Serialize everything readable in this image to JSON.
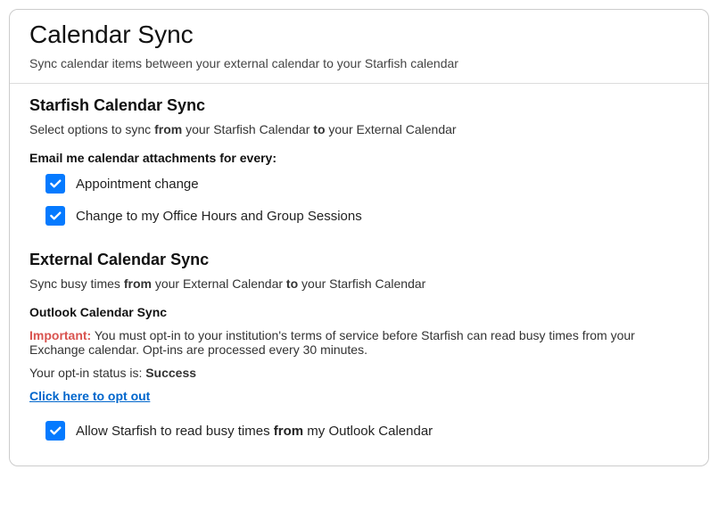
{
  "header": {
    "title": "Calendar Sync",
    "subtitle": "Sync calendar items between your external calendar to your Starfish calendar"
  },
  "starfish_sync": {
    "title": "Starfish Calendar Sync",
    "desc_prefix": "Select options to sync ",
    "desc_from": "from",
    "desc_mid": " your Starfish Calendar ",
    "desc_to": "to",
    "desc_suffix": " your External Calendar",
    "email_heading": "Email me calendar attachments for every:",
    "opt1": "Appointment change",
    "opt2": "Change to my Office Hours and Group Sessions"
  },
  "external_sync": {
    "title": "External Calendar Sync",
    "desc_prefix": "Sync busy times ",
    "desc_from": "from",
    "desc_mid": " your External Calendar ",
    "desc_to": "to",
    "desc_suffix": " your Starfish Calendar",
    "outlook_title": "Outlook Calendar Sync",
    "important_label": "Important:",
    "important_text": " You must opt-in to your institution's terms of service before Starfish can read busy times from your Exchange calendar. Opt-ins are processed every 30 minutes.",
    "status_prefix": "Your opt-in status is: ",
    "status_value": "Success",
    "opt_out_link": "Click here to opt out",
    "allow_prefix": "Allow Starfish to read busy times ",
    "allow_from": "from",
    "allow_suffix": " my Outlook Calendar"
  }
}
